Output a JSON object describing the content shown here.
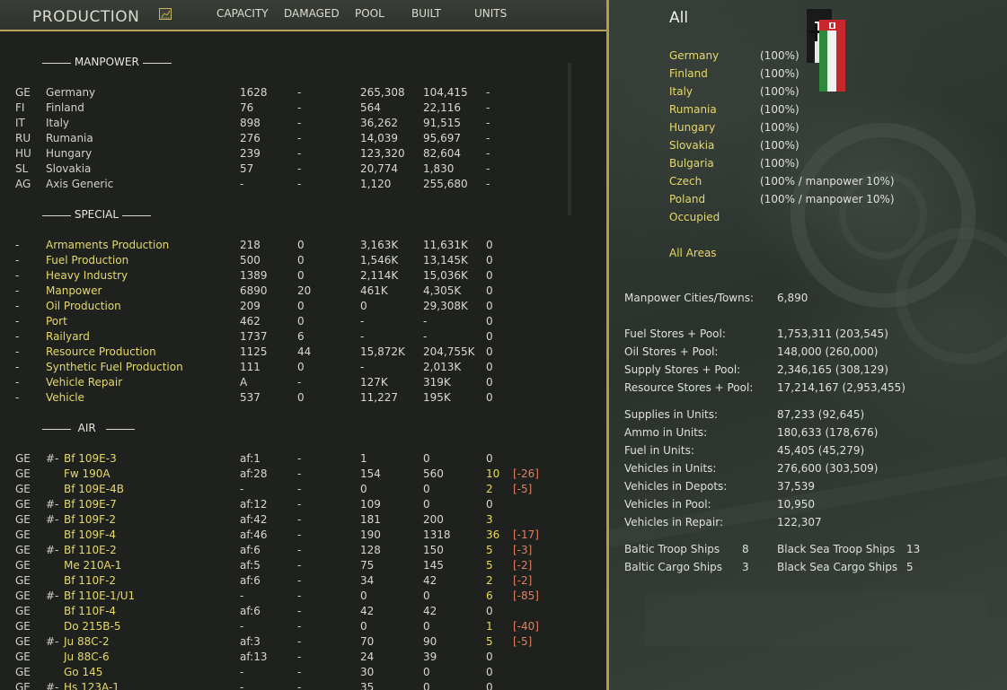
{
  "header": {
    "title": "PRODUCTION",
    "columns": {
      "capacity": "CAPACITY",
      "damaged": "DAMAGED",
      "pool": "POOL",
      "built": "BUILT",
      "units": "UNITS"
    }
  },
  "sections": {
    "manpower": "MANPOWER",
    "special": "SPECIAL",
    "air": "AIR"
  },
  "manpower_rows": [
    {
      "code": "GE",
      "name": "Germany",
      "cap": "1628",
      "dmg": "-",
      "pool": "265,308",
      "built": "104,415",
      "units": "-"
    },
    {
      "code": "FI",
      "name": "Finland",
      "cap": "76",
      "dmg": "-",
      "pool": "564",
      "built": "22,116",
      "units": "-"
    },
    {
      "code": "IT",
      "name": "Italy",
      "cap": "898",
      "dmg": "-",
      "pool": "36,262",
      "built": "91,515",
      "units": "-"
    },
    {
      "code": "RU",
      "name": "Rumania",
      "cap": "276",
      "dmg": "-",
      "pool": "14,039",
      "built": "95,697",
      "units": "-"
    },
    {
      "code": "HU",
      "name": "Hungary",
      "cap": "239",
      "dmg": "-",
      "pool": "123,320",
      "built": "82,604",
      "units": "-"
    },
    {
      "code": "SL",
      "name": "Slovakia",
      "cap": "57",
      "dmg": "-",
      "pool": "20,774",
      "built": "1,830",
      "units": "-"
    },
    {
      "code": "AG",
      "name": "Axis Generic",
      "cap": "-",
      "dmg": "-",
      "pool": "1,120",
      "built": "255,680",
      "units": "-"
    }
  ],
  "special_rows": [
    {
      "code": "-",
      "name": "Armaments Production",
      "cap": "218",
      "dmg": "0",
      "pool": "3,163K",
      "built": "11,631K",
      "units": "0"
    },
    {
      "code": "-",
      "name": "Fuel Production",
      "cap": "500",
      "dmg": "0",
      "pool": "1,546K",
      "built": "13,145K",
      "units": "0"
    },
    {
      "code": "-",
      "name": "Heavy Industry",
      "cap": "1389",
      "dmg": "0",
      "pool": "2,114K",
      "built": "15,036K",
      "units": "0"
    },
    {
      "code": "-",
      "name": "Manpower",
      "cap": "6890",
      "dmg": "20",
      "pool": "461K",
      "built": "4,305K",
      "units": "0"
    },
    {
      "code": "-",
      "name": "Oil Production",
      "cap": "209",
      "dmg": "0",
      "pool": "0",
      "built": "29,308K",
      "units": "0"
    },
    {
      "code": "-",
      "name": "Port",
      "cap": "462",
      "dmg": "0",
      "pool": "-",
      "built": "-",
      "units": "0"
    },
    {
      "code": "-",
      "name": "Railyard",
      "cap": "1737",
      "dmg": "6",
      "pool": "-",
      "built": "-",
      "units": "0"
    },
    {
      "code": "-",
      "name": "Resource Production",
      "cap": "1125",
      "dmg": "44",
      "pool": "15,872K",
      "built": "204,755K",
      "units": "0"
    },
    {
      "code": "-",
      "name": "Synthetic Fuel Production",
      "cap": "111",
      "dmg": "0",
      "pool": "-",
      "built": "2,013K",
      "units": "0"
    },
    {
      "code": "-",
      "name": "Vehicle Repair",
      "cap": "A",
      "dmg": "-",
      "pool": "127K",
      "built": "319K",
      "units": "0"
    },
    {
      "code": "-",
      "name": "Vehicle",
      "cap": "537",
      "dmg": "0",
      "pool": "11,227",
      "built": "195K",
      "units": "0"
    }
  ],
  "air_rows": [
    {
      "code": "GE",
      "pre": "#-",
      "name": "Bf 109E-3",
      "cap": "af:1",
      "dmg": "-",
      "pool": "1",
      "built": "0",
      "units": "0",
      "adj": ""
    },
    {
      "code": "GE",
      "pre": "",
      "name": "Fw 190A",
      "cap": "af:28",
      "dmg": "-",
      "pool": "154",
      "built": "560",
      "units": "10",
      "adj": "[-26]"
    },
    {
      "code": "GE",
      "pre": "",
      "name": "Bf 109E-4B",
      "cap": "-",
      "dmg": "-",
      "pool": "0",
      "built": "0",
      "units": "2",
      "adj": "[-5]"
    },
    {
      "code": "GE",
      "pre": "#-",
      "name": "Bf 109E-7",
      "cap": "af:12",
      "dmg": "-",
      "pool": "109",
      "built": "0",
      "units": "0",
      "adj": ""
    },
    {
      "code": "GE",
      "pre": "#-",
      "name": "Bf 109F-2",
      "cap": "af:42",
      "dmg": "-",
      "pool": "181",
      "built": "200",
      "units": "3",
      "adj": ""
    },
    {
      "code": "GE",
      "pre": "",
      "name": "Bf 109F-4",
      "cap": "af:46",
      "dmg": "-",
      "pool": "190",
      "built": "1318",
      "units": "36",
      "adj": "[-17]"
    },
    {
      "code": "GE",
      "pre": "#-",
      "name": "Bf 110E-2",
      "cap": "af:6",
      "dmg": "-",
      "pool": "128",
      "built": "150",
      "units": "5",
      "adj": "[-3]"
    },
    {
      "code": "GE",
      "pre": "",
      "name": "Me 210A-1",
      "cap": "af:5",
      "dmg": "-",
      "pool": "75",
      "built": "145",
      "units": "5",
      "adj": "[-2]"
    },
    {
      "code": "GE",
      "pre": "",
      "name": "Bf 110F-2",
      "cap": "af:6",
      "dmg": "-",
      "pool": "34",
      "built": "42",
      "units": "2",
      "adj": "[-2]"
    },
    {
      "code": "GE",
      "pre": "#-",
      "name": "Bf 110E-1/U1",
      "cap": "-",
      "dmg": "-",
      "pool": "0",
      "built": "0",
      "units": "6",
      "adj": "[-85]"
    },
    {
      "code": "GE",
      "pre": "",
      "name": "Bf 110F-4",
      "cap": "af:6",
      "dmg": "-",
      "pool": "42",
      "built": "42",
      "units": "0",
      "adj": ""
    },
    {
      "code": "GE",
      "pre": "",
      "name": "Do 215B-5",
      "cap": "-",
      "dmg": "-",
      "pool": "0",
      "built": "0",
      "units": "1",
      "adj": "[-40]"
    },
    {
      "code": "GE",
      "pre": "#-",
      "name": "Ju 88C-2",
      "cap": "af:3",
      "dmg": "-",
      "pool": "70",
      "built": "90",
      "units": "5",
      "adj": "[-5]"
    },
    {
      "code": "GE",
      "pre": "",
      "name": "Ju 88C-6",
      "cap": "af:13",
      "dmg": "-",
      "pool": "24",
      "built": "39",
      "units": "0",
      "adj": ""
    },
    {
      "code": "GE",
      "pre": "",
      "name": "Go 145",
      "cap": "-",
      "dmg": "-",
      "pool": "30",
      "built": "0",
      "units": "0",
      "adj": ""
    },
    {
      "code": "GE",
      "pre": "#-",
      "name": "Hs 123A-1",
      "cap": "-",
      "dmg": "-",
      "pool": "35",
      "built": "0",
      "units": "0",
      "adj": ""
    }
  ],
  "right": {
    "title": "All",
    "nations": [
      {
        "name": "Germany",
        "pct": "(100%)"
      },
      {
        "name": "Finland",
        "pct": "(100%)"
      },
      {
        "name": "Italy",
        "pct": "(100%)"
      },
      {
        "name": "Rumania",
        "pct": "(100%)"
      },
      {
        "name": "Hungary",
        "pct": "(100%)"
      },
      {
        "name": "Slovakia",
        "pct": "(100%)"
      },
      {
        "name": "Bulgaria",
        "pct": "(100%)"
      },
      {
        "name": "Czech",
        "pct": "(100% / manpower 10%)"
      },
      {
        "name": "Poland",
        "pct": "(100% / manpower 10%)"
      },
      {
        "name": "Occupied",
        "pct": ""
      }
    ],
    "all_areas": "All Areas",
    "stats": [
      {
        "label": "Manpower Cities/Towns:",
        "value": "6,890"
      },
      {
        "label": "Fuel Stores + Pool:",
        "value": "1,753,311 (203,545)"
      },
      {
        "label": "Oil Stores + Pool:",
        "value": "148,000 (260,000)"
      },
      {
        "label": "Supply Stores + Pool:",
        "value": "2,346,165 (308,129)"
      },
      {
        "label": "Resource Stores + Pool:",
        "value": "17,214,167 (2,953,455)"
      },
      {
        "label": "Supplies in Units:",
        "value": "87,233 (92,645)"
      },
      {
        "label": "Ammo in Units:",
        "value": "180,633 (178,676)"
      },
      {
        "label": "Fuel in Units:",
        "value": "45,405 (45,279)"
      },
      {
        "label": "Vehicles in Units:",
        "value": "276,600 (303,509)"
      },
      {
        "label": "Vehicles in Depots:",
        "value": "37,539"
      },
      {
        "label": "Vehicles in Pool:",
        "value": "10,950"
      },
      {
        "label": "Vehicles in Repair:",
        "value": "122,307"
      }
    ],
    "ships": {
      "baltic_troop_label": "Baltic Troop Ships",
      "baltic_troop_value": "8",
      "baltic_cargo_label": "Baltic Cargo Ships",
      "baltic_cargo_value": "3",
      "black_troop_label": "Black Sea Troop Ships",
      "black_troop_value": "13",
      "black_cargo_label": "Black Sea Cargo Ships",
      "black_cargo_value": "5"
    }
  },
  "colors": {
    "accent_gold": "#b59c45",
    "name_yellow": "#e6d96a",
    "units_yellow": "#eadb5a",
    "adj_red": "#e37f5e",
    "panel_bg": "#1e211e"
  },
  "icons": {
    "chart_button": "chart-icon",
    "flags": "axis-flags-icon"
  }
}
